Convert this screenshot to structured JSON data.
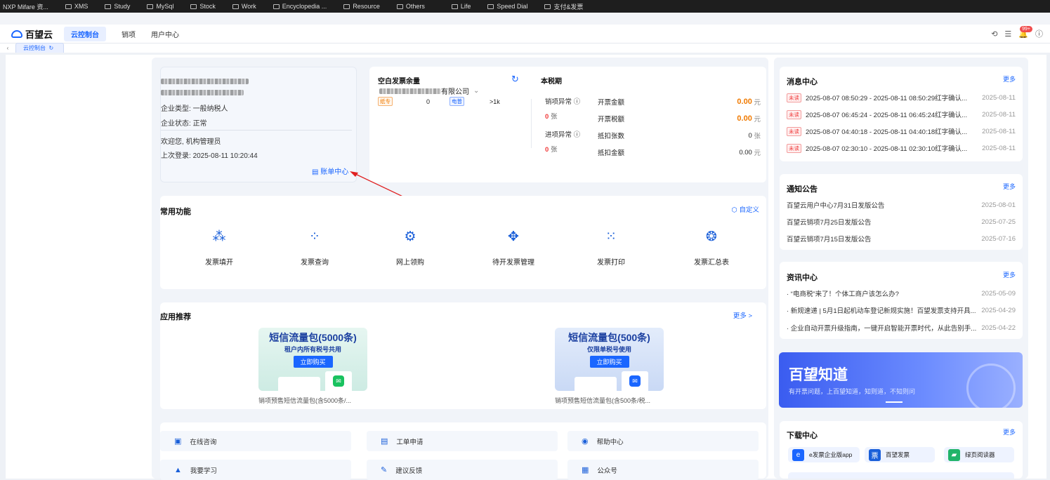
{
  "bookmarks": [
    "NXP Mifare 资...",
    "XMS",
    "Study",
    "MySql",
    "Stock",
    "Work",
    "Encyclopedia ...",
    "Resource",
    "Others",
    "Life",
    "Speed Dial",
    "支付&发票"
  ],
  "app": {
    "name": "百望云",
    "tabs": [
      "云控制台",
      "销项",
      "用户中心"
    ],
    "badge": "99+"
  },
  "tabbar": {
    "back": "‹",
    "current": "云控制台",
    "refresh": "↻"
  },
  "enterprise": {
    "type_label": "企业类型:",
    "type": "一般纳税人",
    "status_label": "企业状态:",
    "status": "正常",
    "welcome": "欢迎您,",
    "role": "机构管理员",
    "last_login_label": "上次登录:",
    "last_login": "2025-08-11 10:20:44",
    "bill_center": "账单中心"
  },
  "blank": {
    "title": "空白发票余量",
    "company_suffix": "有限公司",
    "types": [
      {
        "tag": "纸专",
        "count": "0"
      },
      {
        "tag": "电普",
        "count": ">1k"
      }
    ]
  },
  "period": {
    "title": "本税期",
    "sales_abn": "销项异常",
    "sales_abn_count": "0",
    "purchase_abn": "进项异常",
    "purchase_abn_count": "0",
    "unit_zhang": "张",
    "rows": [
      {
        "label": "开票金额",
        "value": "0.00",
        "unit": "元"
      },
      {
        "label": "开票税额",
        "value": "0.00",
        "unit": "元"
      },
      {
        "label": "抵扣张数",
        "value": "0",
        "unit": "张"
      },
      {
        "label": "抵扣金额",
        "value": "0.00",
        "unit": "元"
      }
    ]
  },
  "functions": {
    "title": "常用功能",
    "custom": "自定义",
    "items": [
      "发票填开",
      "发票查询",
      "网上领购",
      "待开发票管理",
      "发票打印",
      "发票汇总表"
    ]
  },
  "apps": {
    "title": "应用推荐",
    "more": "更多 >",
    "items": [
      {
        "title": "短信流量包(5000条)",
        "sub": "租户内所有税号共用",
        "btn": "立即购买",
        "caption": "销项预售短信流量包(含5000条/..."
      },
      {
        "title": "短信流量包(500条)",
        "sub": "仅限单税号使用",
        "btn": "立即购买",
        "caption": "销项预售短信流量包(含500条/税..."
      }
    ]
  },
  "services": [
    "在线咨询",
    "工单申请",
    "帮助中心",
    "我要学习",
    "建议反馈",
    "公众号"
  ],
  "messages": {
    "title": "消息中心",
    "more": "更多",
    "items": [
      {
        "tag": "未读",
        "text": "2025-08-07 08:50:29 - 2025-08-11 08:50:29红字确认...",
        "date": "2025-08-11"
      },
      {
        "tag": "未读",
        "text": "2025-08-07 06:45:24 - 2025-08-11 06:45:24红字确认...",
        "date": "2025-08-11"
      },
      {
        "tag": "未读",
        "text": "2025-08-07 04:40:18 - 2025-08-11 04:40:18红字确认...",
        "date": "2025-08-11"
      },
      {
        "tag": "未读",
        "text": "2025-08-07 02:30:10 - 2025-08-11 02:30:10红字确认...",
        "date": "2025-08-11"
      }
    ]
  },
  "notices": {
    "title": "通知公告",
    "more": "更多",
    "items": [
      {
        "text": "百望云用户中心7月31日发版公告",
        "date": "2025-08-01"
      },
      {
        "text": "百望云销项7月25日发版公告",
        "date": "2025-07-25"
      },
      {
        "text": "百望云销项7月15日发版公告",
        "date": "2025-07-16"
      }
    ]
  },
  "news": {
    "title": "资讯中心",
    "more": "更多",
    "items": [
      {
        "text": "· “电商税”来了！个体工商户该怎么办?",
        "date": "2025-05-09"
      },
      {
        "text": "· 新规速递 | 5月1日起机动车登记新规实施！百望发票支持开具...",
        "date": "2025-04-29"
      },
      {
        "text": "· 企业自动开票升级指南，一键开启智能开票时代，从此告别手...",
        "date": "2025-04-22"
      }
    ]
  },
  "banner": {
    "title": "百望知道",
    "sub": "有开票问题，上百望知道，知则道，不知则问"
  },
  "downloads": {
    "title": "下载中心",
    "more": "更多",
    "items": [
      "e发票企业版app",
      "百望发票",
      "绿页阅读器"
    ]
  },
  "colors": {
    "primary": "#1a66ff",
    "danger": "#f03a3a",
    "amount": "#f07a00"
  }
}
